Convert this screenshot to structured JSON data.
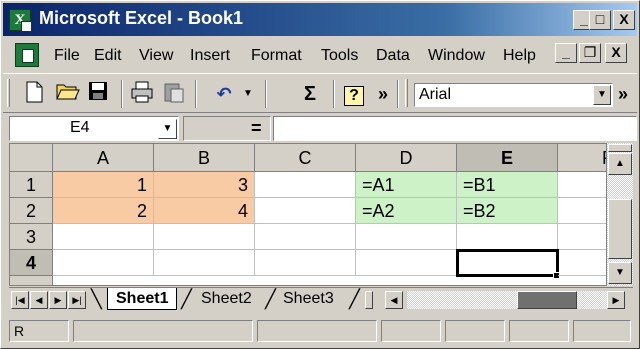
{
  "window": {
    "title": "Microsoft Excel - Book1",
    "controls": {
      "minimize": "_",
      "maximize": "□",
      "close": "X"
    }
  },
  "menu": {
    "items": [
      "File",
      "Edit",
      "View",
      "Insert",
      "Format",
      "Tools",
      "Data",
      "Window",
      "Help"
    ],
    "doc_controls": {
      "minimize": "_",
      "restore": "❐",
      "close": "X"
    }
  },
  "toolbar": {
    "icons": [
      "new-icon",
      "open-icon",
      "save-icon",
      "print-icon",
      "paste-icon",
      "undo-icon",
      "autosum-icon",
      "help-icon"
    ],
    "autosum_glyph": "Σ",
    "help_glyph": "?",
    "overflow_glyph": "»",
    "font_name": "Arial"
  },
  "formula_bar": {
    "name_box": "E4",
    "equals": "=",
    "value": ""
  },
  "grid": {
    "columns": [
      "A",
      "B",
      "C",
      "D",
      "E",
      "F"
    ],
    "rows": [
      "1",
      "2",
      "3",
      "4"
    ],
    "active_cell": "E4",
    "active_column": "E",
    "active_row": "4",
    "cells": {
      "A1": "1",
      "B1": "3",
      "D1": "=A1",
      "E1": "=B1",
      "A2": "2",
      "B2": "4",
      "D2": "=A2",
      "E2": "=B2"
    },
    "colors": {
      "input_fill": "#f8cba4",
      "formula_fill": "#cdf2c8"
    }
  },
  "sheets": {
    "tabs": [
      "Sheet1",
      "Sheet2",
      "Sheet3"
    ],
    "active": "Sheet1"
  },
  "status": {
    "text": "R"
  }
}
